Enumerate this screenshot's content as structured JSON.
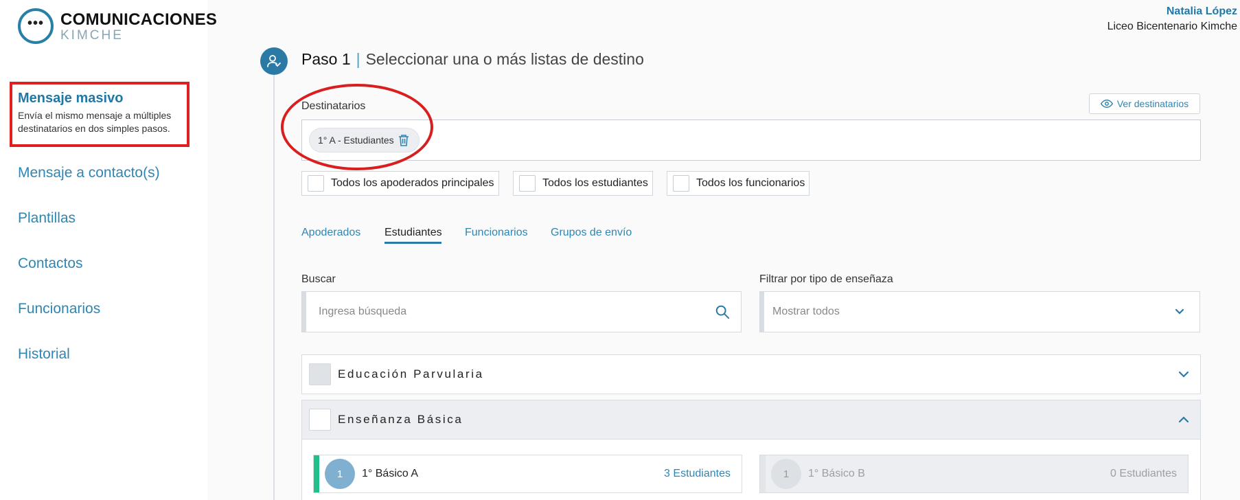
{
  "app": {
    "title": "COMUNICACIONES",
    "subtitle": "KIMCHE"
  },
  "user": {
    "name": "Natalia López",
    "school": "Liceo Bicentenario Kimche"
  },
  "sidebar": {
    "active": {
      "title": "Mensaje masivo",
      "description": "Envía el mismo mensaje a múltiples destinatarios en dos simples pasos."
    },
    "items": [
      {
        "label": "Mensaje a contacto(s)"
      },
      {
        "label": "Plantillas"
      },
      {
        "label": "Contactos"
      },
      {
        "label": "Funcionarios"
      },
      {
        "label": "Historial"
      }
    ]
  },
  "step": {
    "number": "Paso 1",
    "separator": "|",
    "description": "Seleccionar una o más listas de destino"
  },
  "recipients": {
    "label": "Destinatarios",
    "view_button": "Ver destinatarios",
    "chips": [
      "1° A - Estudiantes"
    ]
  },
  "quick_select": [
    {
      "label": "Todos los apoderados principales",
      "checked": false
    },
    {
      "label": "Todos los estudiantes",
      "checked": false
    },
    {
      "label": "Todos los funcionarios",
      "checked": false
    }
  ],
  "tabs": [
    {
      "label": "Apoderados",
      "active": false
    },
    {
      "label": "Estudiantes",
      "active": true
    },
    {
      "label": "Funcionarios",
      "active": false
    },
    {
      "label": "Grupos de envío",
      "active": false
    }
  ],
  "search": {
    "label": "Buscar",
    "placeholder": "Ingresa búsqueda"
  },
  "filter": {
    "label": "Filtrar por tipo de enseñaza",
    "value": "Mostrar todos"
  },
  "sections": [
    {
      "title": "Educación Parvularia",
      "expanded": false
    },
    {
      "title": "Enseñanza Básica",
      "expanded": true
    }
  ],
  "courses": [
    {
      "badge": "1",
      "name": "1° Básico A",
      "count": "3 Estudiantes",
      "enabled": true
    },
    {
      "badge": "1",
      "name": "1° Básico B",
      "count": "0 Estudiantes",
      "enabled": false
    }
  ],
  "colors": {
    "accent": "#2b7aa6",
    "link": "#2d86b3",
    "highlight": "#e02020",
    "course_bar_active": "#1fc08a"
  }
}
